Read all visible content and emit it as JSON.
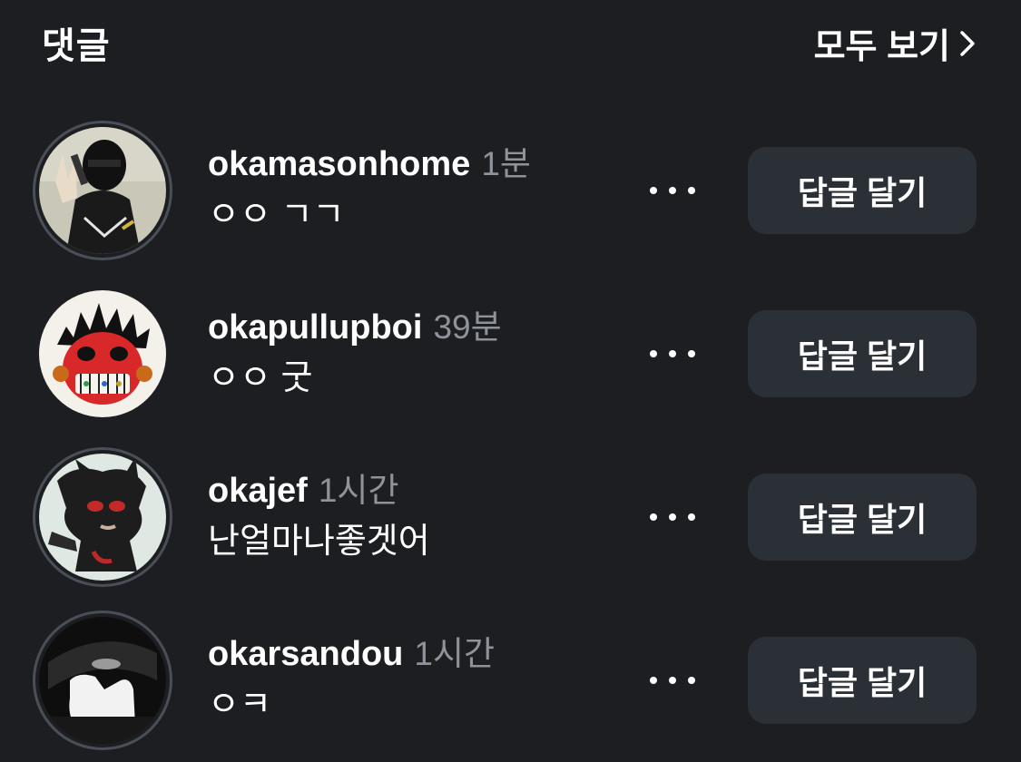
{
  "header": {
    "title": "댓글",
    "see_all_label": "모두 보기",
    "see_all_icon": "chevron-right-icon"
  },
  "comments": [
    {
      "username": "okamasonhome",
      "time": "1분",
      "text": "ㅇㅇ ㄱㄱ",
      "reply_label": "답글 달기",
      "more_icon": "more-horizontal-icon"
    },
    {
      "username": "okapullupboi",
      "time": "39분",
      "text": "ㅇㅇ 굿",
      "reply_label": "답글 달기",
      "more_icon": "more-horizontal-icon"
    },
    {
      "username": "okajef",
      "time": "1시간",
      "text": "난얼마나좋겟어",
      "reply_label": "답글 달기",
      "more_icon": "more-horizontal-icon"
    },
    {
      "username": "okarsandou",
      "time": "1시간",
      "text": "ㅇㅋ",
      "reply_label": "답글 달기",
      "more_icon": "more-horizontal-icon"
    }
  ],
  "colors": {
    "background": "#1c1e22",
    "button_bg": "#2b2f36",
    "time_text": "#8e9299",
    "primary_text": "#ffffff",
    "avatar_ring": "#4a4e56"
  }
}
